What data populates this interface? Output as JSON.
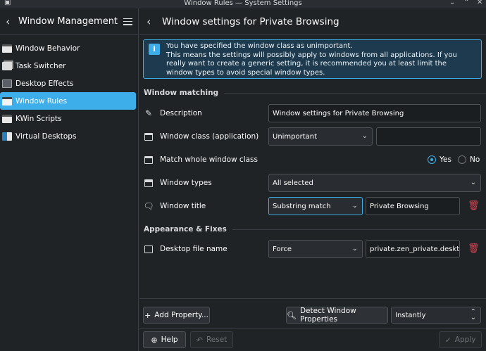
{
  "window": {
    "title": "Window Rules — System Settings"
  },
  "sidebar": {
    "title": "Window Management",
    "items": [
      {
        "label": "Window Behavior",
        "icon": "window-behavior-icon"
      },
      {
        "label": "Task Switcher",
        "icon": "task-switcher-icon"
      },
      {
        "label": "Desktop Effects",
        "icon": "desktop-effects-icon"
      },
      {
        "label": "Window Rules",
        "icon": "window-rules-icon",
        "active": true
      },
      {
        "label": "KWin Scripts",
        "icon": "kwin-scripts-icon"
      },
      {
        "label": "Virtual Desktops",
        "icon": "virtual-desktops-icon"
      }
    ]
  },
  "main": {
    "title": "Window settings for Private Browsing",
    "info": {
      "line1": "You have specified the window class as unimportant.",
      "line2": "This means the settings will possibly apply to windows from all applications. If you really want to create a generic setting, it is recommended you at least limit the window types to avoid special window types."
    },
    "sections": {
      "matching": "Window matching",
      "appearance": "Appearance & Fixes"
    },
    "rows": {
      "description": {
        "label": "Description",
        "value": "Window settings for Private Browsing"
      },
      "window_class": {
        "label": "Window class (application)",
        "policy": "Unimportant",
        "value": ""
      },
      "whole_class": {
        "label": "Match whole window class",
        "yes": "Yes",
        "no": "No",
        "selected": "Yes"
      },
      "window_types": {
        "label": "Window types",
        "value": "All selected"
      },
      "window_title": {
        "label": "Window title",
        "policy": "Substring match",
        "value": "Private Browsing"
      },
      "desktop_file": {
        "label": "Desktop file name",
        "policy": "Force",
        "value": "private.zen_private.desktop"
      }
    },
    "footer": {
      "add_property": "Add Property...",
      "detect": "Detect Window Properties",
      "detect_delay": "Instantly",
      "help": "Help",
      "reset": "Reset",
      "apply": "Apply"
    }
  },
  "colors": {
    "accent": "#3daee9",
    "background": "#202326",
    "danger": "#da4453"
  }
}
